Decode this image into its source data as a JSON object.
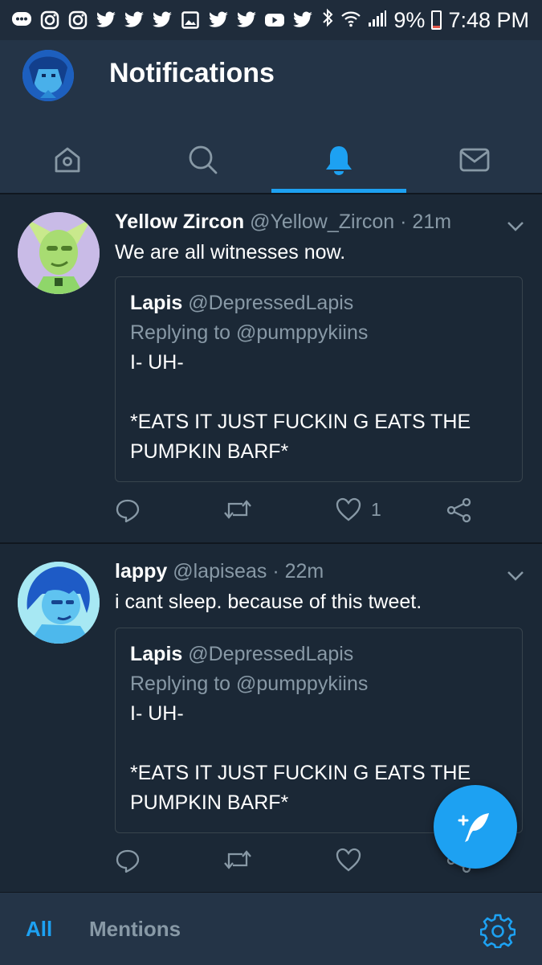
{
  "status_bar": {
    "icons": [
      "messages-icon",
      "instagram-icon",
      "instagram-icon",
      "twitter-icon",
      "twitter-icon",
      "twitter-icon",
      "gallery-icon",
      "twitter-icon",
      "twitter-icon",
      "youtube-icon",
      "twitter-icon",
      "bluetooth-icon",
      "wifi-icon",
      "signal-icon"
    ],
    "battery": "9%",
    "time": "7:48 PM"
  },
  "header": {
    "title": "Notifications",
    "tabs": [
      {
        "name": "home",
        "icon": "home-icon"
      },
      {
        "name": "search",
        "icon": "search-icon"
      },
      {
        "name": "notifications",
        "icon": "bell-icon",
        "active": true
      },
      {
        "name": "messages",
        "icon": "mail-icon"
      }
    ]
  },
  "tweets": [
    {
      "name": "Yellow Zircon",
      "handle": "@Yellow_Zircon",
      "time": "· 21m",
      "text": "We are all witnesses now.",
      "quote": {
        "name": "Lapis",
        "handle": "@DepressedLapis",
        "reply": "Replying to @pumppykiins",
        "line1": "I- UH-",
        "line2": "*EATS IT JUST FUCKIN G EATS THE PUMPKIN BARF*"
      },
      "likes": "1"
    },
    {
      "name": "lappy",
      "handle": "@lapiseas",
      "time": "· 22m",
      "text": "i cant sleep. because of this tweet.",
      "quote": {
        "name": "Lapis",
        "handle": "@DepressedLapis",
        "reply": "Replying to @pumppykiins",
        "line1": "I- UH-",
        "line2": "*EATS IT JUST FUCKIN G EATS THE PUMPKIN BARF*"
      },
      "likes": ""
    }
  ],
  "bottom_bar": {
    "all_label": "All",
    "mentions_label": "Mentions"
  },
  "colors": {
    "background": "#1b2836",
    "header": "#243447",
    "accent": "#1da1f2",
    "secondary_text": "#8899a6"
  }
}
